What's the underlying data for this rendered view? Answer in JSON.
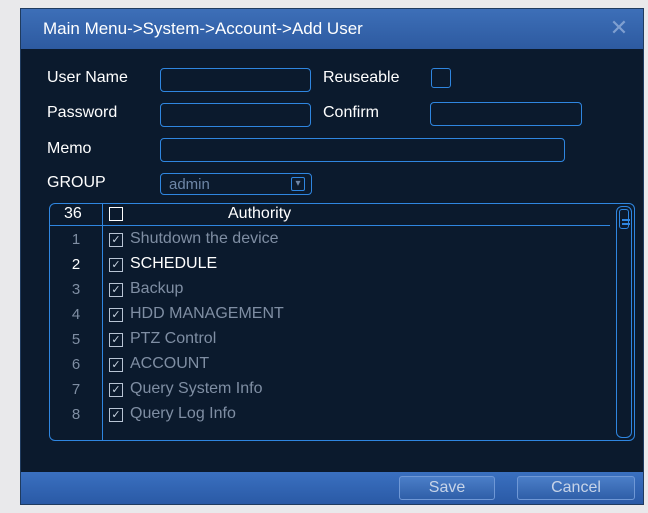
{
  "window": {
    "title": "Main Menu->System->Account->Add User",
    "close_icon": "close-icon"
  },
  "form": {
    "user_name_label": "User Name",
    "user_name_value": "",
    "reuseable_label": "Reuseable",
    "reuseable_checked": false,
    "password_label": "Password",
    "password_value": "",
    "confirm_label": "Confirm",
    "confirm_value": "",
    "memo_label": "Memo",
    "memo_value": "",
    "group_label": "GROUP",
    "group_value": "admin"
  },
  "authority": {
    "count": "36",
    "header": "Authority",
    "rows": [
      {
        "num": "1",
        "label": "Shutdown the device",
        "checked": true
      },
      {
        "num": "2",
        "label": "SCHEDULE",
        "checked": true
      },
      {
        "num": "3",
        "label": "Backup",
        "checked": true
      },
      {
        "num": "4",
        "label": "HDD MANAGEMENT",
        "checked": true
      },
      {
        "num": "5",
        "label": "PTZ Control",
        "checked": true
      },
      {
        "num": "6",
        "label": "ACCOUNT",
        "checked": true
      },
      {
        "num": "7",
        "label": "Query System Info",
        "checked": true
      },
      {
        "num": "8",
        "label": "Query Log Info",
        "checked": true
      }
    ]
  },
  "buttons": {
    "save": "Save",
    "cancel": "Cancel"
  },
  "colors": {
    "accent": "#2f86e0",
    "titlebar": "#3d6fb8",
    "background": "#0b1a2d"
  }
}
